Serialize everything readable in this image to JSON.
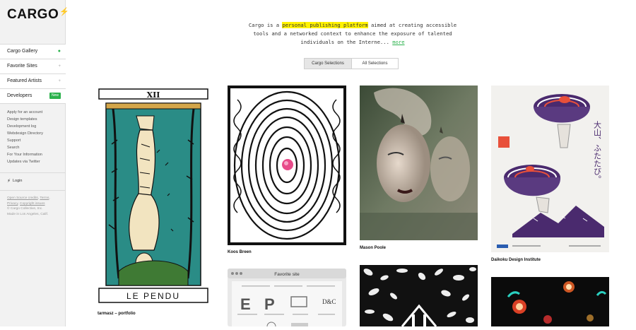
{
  "logo": {
    "text": "CARGO",
    "glyph": "⚡"
  },
  "sidebar": {
    "nav": [
      {
        "label": "Cargo Gallery",
        "mark": "●",
        "active": true
      },
      {
        "label": "Favorite Sites",
        "mark": "+"
      },
      {
        "label": "Featured Artists",
        "mark": "+"
      },
      {
        "label": "Developers",
        "badge": "New"
      }
    ],
    "links": [
      "Apply for an account",
      "Design templates",
      "Development log",
      "Webdesign Directory",
      "Support",
      "Search",
      "For Your Information",
      "Updates via Twitter"
    ],
    "login": "Login",
    "footer": {
      "line1_a": "Open Source credits",
      "line1_b": "Terms",
      "line2_a": "Privacy",
      "line2_b": "Copyright issues",
      "line3": "© Cargo Collective, Inc.",
      "line4": "Made in Los Angeles, Calif."
    }
  },
  "intro": {
    "pre": "Cargo is a ",
    "highlight": "personal publishing platform",
    "post": " aimed at creating accessible tools and a networked context to enhance the exposure of talented individuals on the Interne...",
    "more": "more"
  },
  "tabs": {
    "selected": "Cargo Selections",
    "other": "All Selections"
  },
  "cards": {
    "tarot": {
      "caption": "tarmasz – portfolio",
      "numeral": "XII",
      "title": "LE PENDU"
    },
    "koos": {
      "caption": "Koos Breen"
    },
    "mason": {
      "caption": "Mason Poole"
    },
    "daikoku": {
      "caption": "Daikoku Design Institute",
      "jp": "大山、ふたたび。"
    },
    "fav": {
      "title": "Favorite site",
      "letters": [
        "E",
        "P",
        "D&C"
      ]
    }
  },
  "colors": {
    "accent": "#2bb24c",
    "highlight": "#fff200",
    "teal": "#2a8c86",
    "purple": "#4a2a6e",
    "orange": "#e8503a"
  }
}
